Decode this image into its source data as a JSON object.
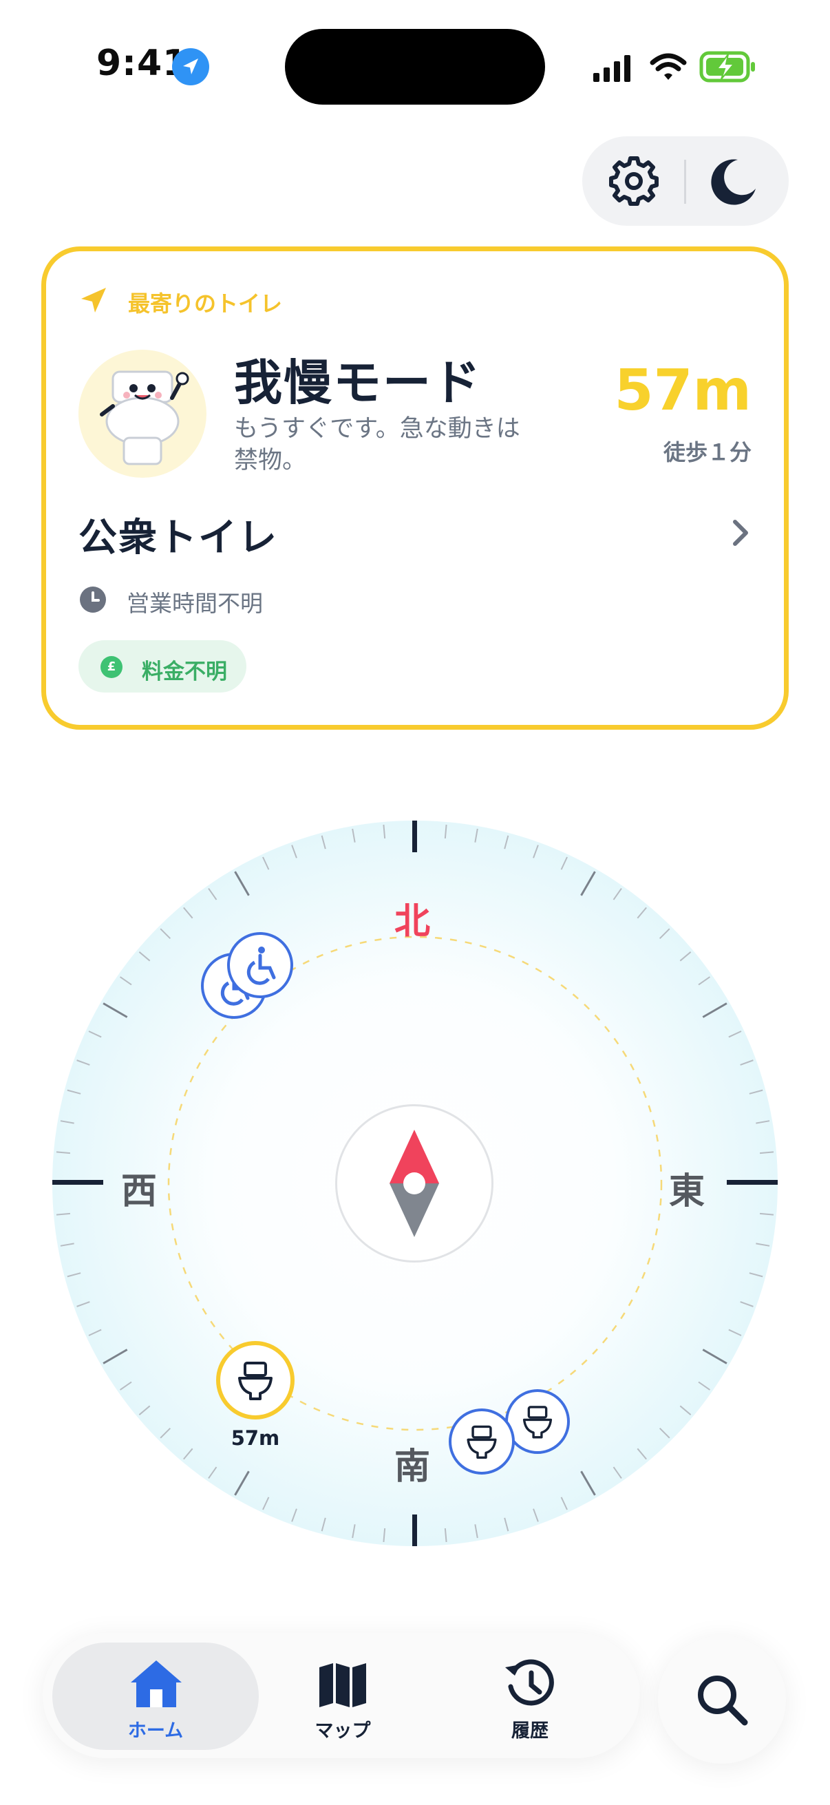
{
  "status_bar": {
    "time": "9:41",
    "icons": [
      "location-arrow-icon",
      "cellular-signal-icon",
      "wifi-icon",
      "battery-charging-icon"
    ]
  },
  "header": {
    "icons": [
      "gear-icon",
      "moon-icon"
    ]
  },
  "nearest_card": {
    "label": "最寄りのトイレ",
    "mode_title": "我慢モード",
    "mode_description": "もうすぐです。急な動きは禁物。",
    "distance": "57m",
    "walk_time": "徒歩１分",
    "place_name": "公衆トイレ",
    "hours": "営業時間不明",
    "fee": "料金不明",
    "accent_color": "#f8cb2e",
    "fee_color": "#3ec273"
  },
  "compass": {
    "north": "北",
    "south": "南",
    "west": "西",
    "east": "東",
    "north_color": "#f0435c",
    "markers": [
      {
        "type": "wheelchair-icon",
        "highlighted": false
      },
      {
        "type": "wheelchair-icon",
        "highlighted": false
      },
      {
        "type": "toilet-icon",
        "highlighted": true,
        "label": "57m"
      },
      {
        "type": "toilet-icon",
        "highlighted": false
      },
      {
        "type": "toilet-icon",
        "highlighted": false
      }
    ]
  },
  "tab_bar": {
    "tabs": [
      {
        "label": "ホーム",
        "icon": "home-icon",
        "active": true
      },
      {
        "label": "マップ",
        "icon": "map-icon",
        "active": false
      },
      {
        "label": "履歴",
        "icon": "history-icon",
        "active": false
      }
    ],
    "search_icon": "search-icon",
    "active_color": "#2d6be4"
  }
}
